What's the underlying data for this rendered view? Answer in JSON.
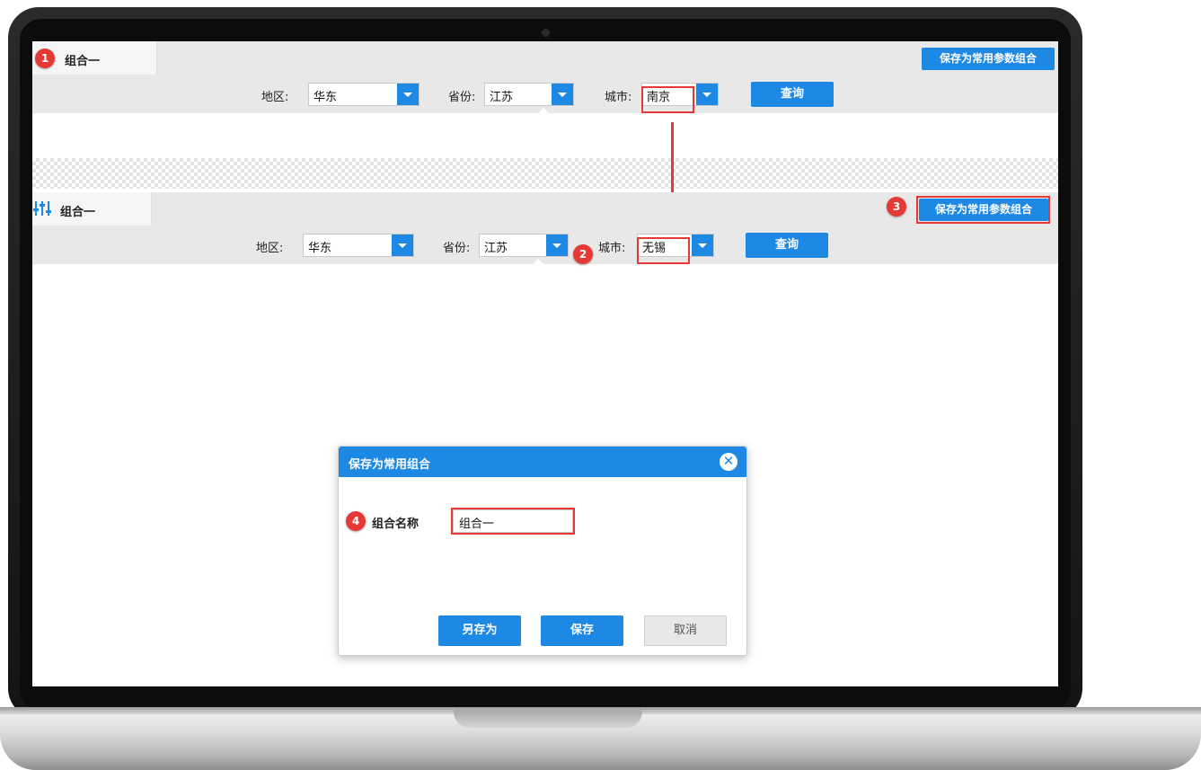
{
  "top_panel": {
    "tab_label": "组合一",
    "save_button": "保存为常用参数组合",
    "region_label": "地区:",
    "region_value": "华东",
    "province_label": "省份:",
    "province_value": "江苏",
    "city_label": "城市:",
    "city_value": "南京",
    "query_button": "查询"
  },
  "bottom_panel": {
    "tab_label": "组合一",
    "save_button": "保存为常用参数组合",
    "region_label": "地区:",
    "region_value": "华东",
    "province_label": "省份:",
    "province_value": "江苏",
    "city_label": "城市:",
    "city_value": "无锡",
    "query_button": "查询"
  },
  "dialog": {
    "title": "保存为常用组合",
    "close_icon": "close-icon",
    "name_label": "组合名称",
    "name_value": "组合一",
    "save_as_button": "另存为",
    "save_button": "保存",
    "cancel_button": "取消"
  },
  "badges": [
    "1",
    "2",
    "3",
    "4"
  ],
  "colors": {
    "accent": "#1e88e5",
    "highlight": "#e53935",
    "toolbar": "#e8e8e8"
  }
}
